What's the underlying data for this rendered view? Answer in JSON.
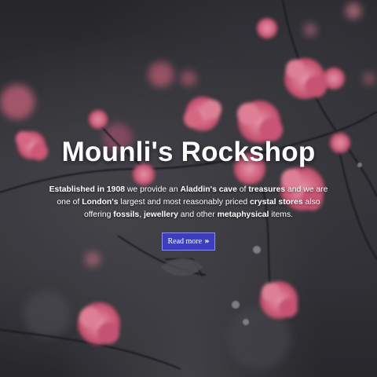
{
  "hero": {
    "title": "Mounli's Rockshop",
    "description": {
      "s1": "Established in 1908",
      "s2": "  we provide an ",
      "s3": "Aladdin's cave",
      "s4": " of ",
      "s5": "treasures",
      "s6": " and we are one of ",
      "s7": "London's",
      "s8": " largest and most reasonably priced ",
      "s9": "crystal stores",
      "s10": " also offering ",
      "s11": "fossils",
      "s12": ", ",
      "s13": "jewellery",
      "s14": " and other ",
      "s15": "metaphysical",
      "s16": " items."
    },
    "button": {
      "label": "Read more",
      "icon": "double-chevron-right-icon",
      "color": "#3b3fbf"
    }
  },
  "colors": {
    "blossom": "#e8708f",
    "background": "#2e2e32"
  }
}
